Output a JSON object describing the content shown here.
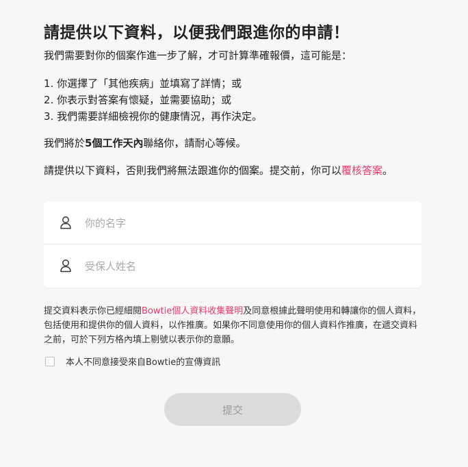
{
  "header": {
    "title": "請提供以下資料，以便我們跟進你的申請！",
    "subtitle": "我們需要對你的個案作進一步了解，才可計算準確報價，這可能是："
  },
  "reasons": [
    "1. 你選擇了「其他疾病」並填寫了詳情；或",
    "2. 你表示對答案有懷疑，並需要協助；或",
    "3. 我們需要詳細檢視你的健康情況，再作決定。"
  ],
  "contact": {
    "prefix": "我們將於",
    "emphasis": "5個工作天內",
    "suffix": "聯絡你，請耐心等候。"
  },
  "provide": {
    "text": "請提供以下資料，否則我們將無法跟進你的個案。提交前，你可以",
    "link": "覆核答案",
    "end": "。"
  },
  "form": {
    "name_placeholder": "你的名字",
    "insured_placeholder": "受保人姓名",
    "icon": "user-icon"
  },
  "consent": {
    "prefix": "提交資料表示你已經細閱",
    "link": "Bowtie個人資料收集聲明",
    "suffix": "及同意根據此聲明使用和轉讓你的個人資料，包括使用和提供你的個人資料，以作推廣。如果你不同意使用你的個人資料作推廣，在遞交資料之前，可於下列方格內填上剔號以表示你的意願。"
  },
  "opt_out": {
    "label": "本人不同意接受來自Bowtie的宣傳資訊"
  },
  "submit": {
    "label": "提交"
  },
  "colors": {
    "accent": "#e8396c",
    "background": "#f7f7f7",
    "disabled_button": "#dcdcdc"
  }
}
